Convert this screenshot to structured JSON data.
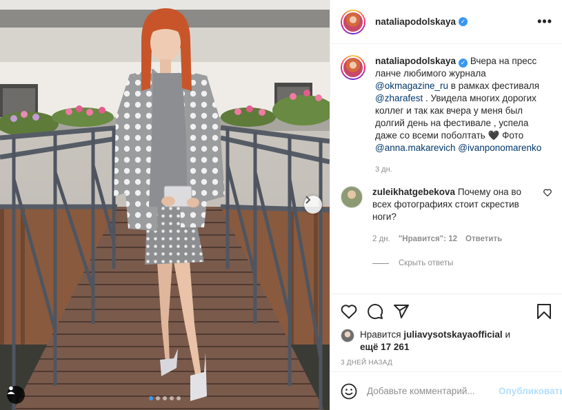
{
  "header": {
    "username": "nataliapodolskaya",
    "more_label": "•••"
  },
  "caption": {
    "username": "nataliapodolskaya",
    "text_1": "Вчера на пресс ланче любимого журнала",
    "mention_1": "@okmagazine_ru",
    "text_2": "в рамках фестиваля",
    "mention_2": "@zharafest",
    "text_3": ". Увидела многих дорогих коллег и так как вчера у меня был долгий день на фестивале , успела даже со всеми поболтать 🖤 Фото",
    "mention_3": "@anna.makarevich",
    "mention_4": "@ivanponomarenko",
    "time": "3 дн."
  },
  "comment": {
    "username": "zuleikhatgebekova",
    "text": "Почему она во всех фотографиях стоит скрестив ноги?",
    "time": "2 дн.",
    "likes": "\"Нравится\": 12",
    "reply_label": "Ответить",
    "hide_replies_label": "Скрыть ответы"
  },
  "likes": {
    "prefix": "Нравится",
    "liker": "juliavysotskayaofficial",
    "and": "и",
    "others": "ещё 17 261"
  },
  "post_date": "3 ДНЕЙ НАЗАД",
  "add_comment": {
    "placeholder": "Добавьте комментарий...",
    "publish_label": "Опубликовать"
  },
  "carousel": {
    "total": 5,
    "current": 1
  },
  "icons": {
    "verified": "verified-badge-icon",
    "like": "heart-icon",
    "comment": "comment-icon",
    "share": "paper-plane-icon",
    "save": "bookmark-icon",
    "emoji": "emoji-icon",
    "next": "chevron-right-icon",
    "tag": "user-tag-icon"
  },
  "colors": {
    "link": "#00376b",
    "verified": "#3897f0",
    "publish_disabled": "#b2dffc",
    "muted": "#8e8e8e"
  }
}
